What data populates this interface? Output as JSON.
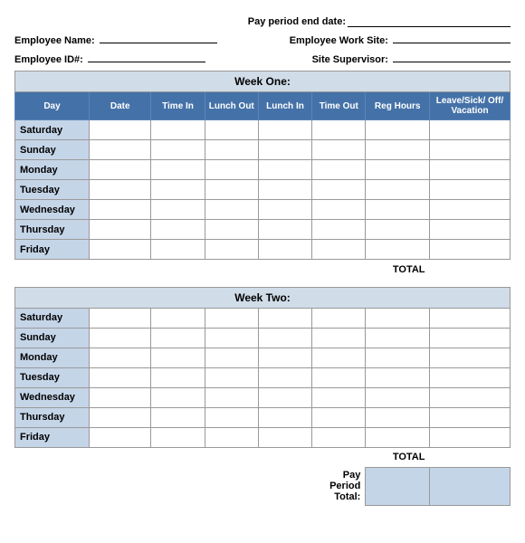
{
  "header": {
    "pay_period_label": "Pay period end date:",
    "employee_name_label": "Employee Name:",
    "employee_worksite_label": "Employee Work Site:",
    "employee_id_label": "Employee ID#:",
    "site_supervisor_label": "Site Supervisor:"
  },
  "week_one": {
    "title": "Week One:",
    "columns": [
      "Day",
      "Date",
      "Time In",
      "Lunch Out",
      "Lunch In",
      "Time Out",
      "Reg Hours",
      "Leave/Sick/ Off/ Vacation"
    ],
    "days": [
      "Saturday",
      "Sunday",
      "Monday",
      "Tuesday",
      "Wednesday",
      "Thursday",
      "Friday"
    ],
    "total_label": "TOTAL"
  },
  "week_two": {
    "title": "Week Two:",
    "days": [
      "Saturday",
      "Sunday",
      "Monday",
      "Tuesday",
      "Wednesday",
      "Thursday",
      "Friday"
    ],
    "total_label": "TOTAL",
    "pay_period_label": "Pay Period Total:"
  }
}
